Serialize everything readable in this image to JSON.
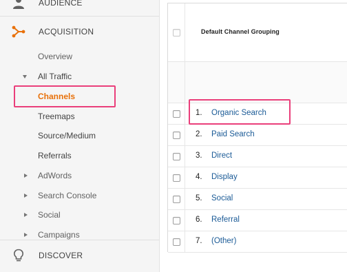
{
  "sidebar": {
    "sections": {
      "audience": {
        "label": "AUDIENCE",
        "icon": "person-icon"
      },
      "acquisition": {
        "label": "ACQUISITION",
        "icon": "acquisition-icon"
      },
      "discover": {
        "label": "DISCOVER",
        "icon": "lightbulb-icon"
      }
    },
    "items": [
      {
        "label": "Overview"
      },
      {
        "label": "All Traffic"
      },
      {
        "label": "Channels"
      },
      {
        "label": "Treemaps"
      },
      {
        "label": "Source/Medium"
      },
      {
        "label": "Referrals"
      },
      {
        "label": "AdWords"
      },
      {
        "label": "Search Console"
      },
      {
        "label": "Social"
      },
      {
        "label": "Campaigns"
      }
    ]
  },
  "table": {
    "header": "Default Channel Grouping",
    "rows": [
      {
        "num": "1.",
        "label": "Organic Search"
      },
      {
        "num": "2.",
        "label": "Paid Search"
      },
      {
        "num": "3.",
        "label": "Direct"
      },
      {
        "num": "4.",
        "label": "Display"
      },
      {
        "num": "5.",
        "label": "Social"
      },
      {
        "num": "6.",
        "label": "Referral"
      },
      {
        "num": "7.",
        "label": "(Other)"
      }
    ]
  },
  "colors": {
    "accent_orange": "#e8710a",
    "highlight_pink": "#ea3e7a",
    "link_blue": "#1a5a96",
    "sidebar_bg": "#f5f5f5"
  }
}
